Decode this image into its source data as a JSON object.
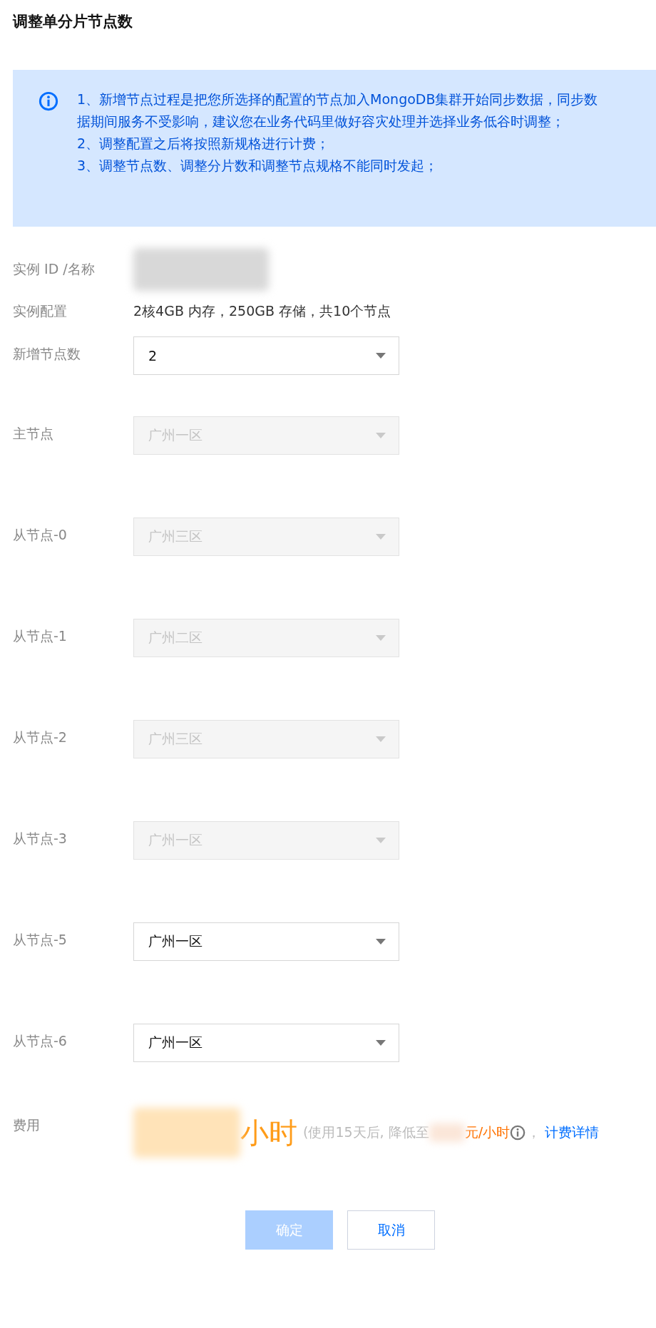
{
  "title": "调整单分片节点数",
  "notice": {
    "lines": [
      "1、新增节点过程是把您所选择的配置的节点加入MongoDB集群开始同步数据，同步数据期间服务不受影响，建议您在业务代码里做好容灾处理并选择业务低谷时调整；",
      "2、调整配置之后将按照新规格进行计费；",
      "3、调整节点数、调整分片数和调整节点规格不能同时发起；"
    ]
  },
  "instance": {
    "label": "实例 ID /名称"
  },
  "config": {
    "label": "实例配置",
    "value": "2核4GB 内存，250GB 存储，共10个节点"
  },
  "add_count": {
    "label": "新增节点数",
    "value": "2",
    "disabled": false
  },
  "nodes": [
    {
      "label": "主节点",
      "value": "广州一区",
      "disabled": true
    },
    {
      "label": "从节点-0",
      "value": "广州三区",
      "disabled": true
    },
    {
      "label": "从节点-1",
      "value": "广州二区",
      "disabled": true
    },
    {
      "label": "从节点-2",
      "value": "广州三区",
      "disabled": true
    },
    {
      "label": "从节点-3",
      "value": "广州一区",
      "disabled": true
    },
    {
      "label": "从节点-5",
      "value": "广州一区",
      "disabled": false
    },
    {
      "label": "从节点-6",
      "value": "广州一区",
      "disabled": false
    }
  ],
  "fee": {
    "label": "费用",
    "unit": "小时",
    "note_prefix": "(使用15天后, 降低至",
    "note_unit": "元/小时",
    "separator": "，",
    "link": "计费详情"
  },
  "buttons": [
    {
      "label": "确定",
      "kind": "primary",
      "disabled": true
    },
    {
      "label": "取消",
      "kind": "default",
      "disabled": false
    }
  ]
}
